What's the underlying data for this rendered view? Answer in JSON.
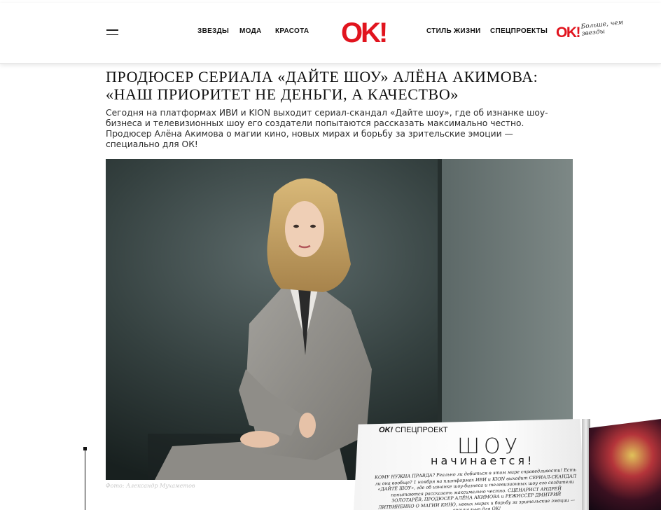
{
  "header": {
    "menu_icon": "hamburger-menu-icon",
    "nav_left": [
      "ЗВЕЗДЫ",
      "МОДА",
      "КРАСОТА"
    ],
    "logo": "OK!",
    "nav_right": [
      "СТИЛЬ ЖИЗНИ",
      "СПЕЦПРОЕКТЫ"
    ],
    "secondary_logo": "OK!",
    "tagline": "Больше, чем звезды",
    "brand_color": "#e1141e"
  },
  "article": {
    "headline": "ПРОДЮСЕР СЕРИАЛА «ДАЙТЕ ШОУ» АЛЁНА АКИМОВА: «НАШ ПРИОРИТЕТ НЕ ДЕНЬГИ, А КАЧЕСТВО»",
    "lead": "Сегодня на платформах ИВИ и KION выходит сериал-скандал «Дайте шоу», где об изнанке шоу-бизнеса и телевизионных шоу его создатели попытаются рассказать максимально честно. Продюсер Алёна Акимова о магии кино, новых мирах и борьбу за зрительские эмоции — специально для ОК!",
    "photo_credit": "Фото: Александр Мухаметов"
  },
  "magazine": {
    "badge_brand": "OK!",
    "badge_label": "СПЕЦПРОЕКТ",
    "title": "ШОУ",
    "subtitle": "начинается!",
    "body": "КОМУ НУЖНА ПРАВДА? Реально ли добиться в этом мире справедливости! Есть ли она вообще? 1 ноября на платформах ИВИ и KION выходит СЕРИАЛ-СКАНДАЛ «ДАЙТЕ ШОУ», где об изнанке шоу-бизнеса и телевизионных шоу его создатели попытаются рассказать максимально честно. СЦЕНАРИСТ АНДРЕЙ ЗОЛОТАРЁВ, ПРОДЮСЕР АЛЁНА АКИМОВА и РЕЖИССЕР ДМИТРИЙ ЛИТВИНЕНКО О МАГИИ КИНО, новых мирах и борьбу за зрительские эмоции — специально для ОК!"
  }
}
